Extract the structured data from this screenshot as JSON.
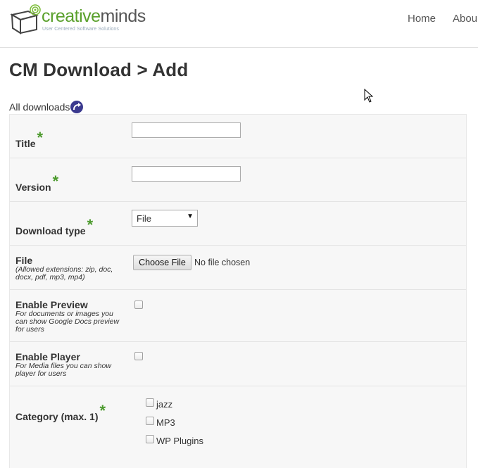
{
  "header": {
    "logo_creative": "creative",
    "logo_minds": "minds",
    "logo_tagline": "User Centered Software Solutions",
    "nav": [
      "Home",
      "Abou"
    ]
  },
  "page_title": "CM Download > Add",
  "all_downloads_link": "All downloads",
  "form": {
    "title": {
      "label": "Title",
      "required": "*",
      "value": ""
    },
    "version": {
      "label": "Version",
      "required": "*",
      "value": ""
    },
    "download_type": {
      "label": "Download type",
      "required": "*",
      "selected": "File"
    },
    "file": {
      "label": "File",
      "hint": "(Allowed extensions: zip, doc, docx, pdf, mp3, mp4)",
      "button": "Choose File",
      "status": "No file chosen"
    },
    "enable_preview": {
      "label": "Enable Preview",
      "hint": "For documents or images you can show Google Docs preview for users",
      "checked": false
    },
    "enable_player": {
      "label": "Enable Player",
      "hint": "For Media files you can show player for users",
      "checked": false
    },
    "category": {
      "label": "Category (max. 1)",
      "required": "*",
      "options": [
        "jazz",
        "MP3",
        "WP Plugins"
      ]
    }
  },
  "colors": {
    "accent_green": "#4b9a2c",
    "icon_purple": "#3b3a8f"
  }
}
